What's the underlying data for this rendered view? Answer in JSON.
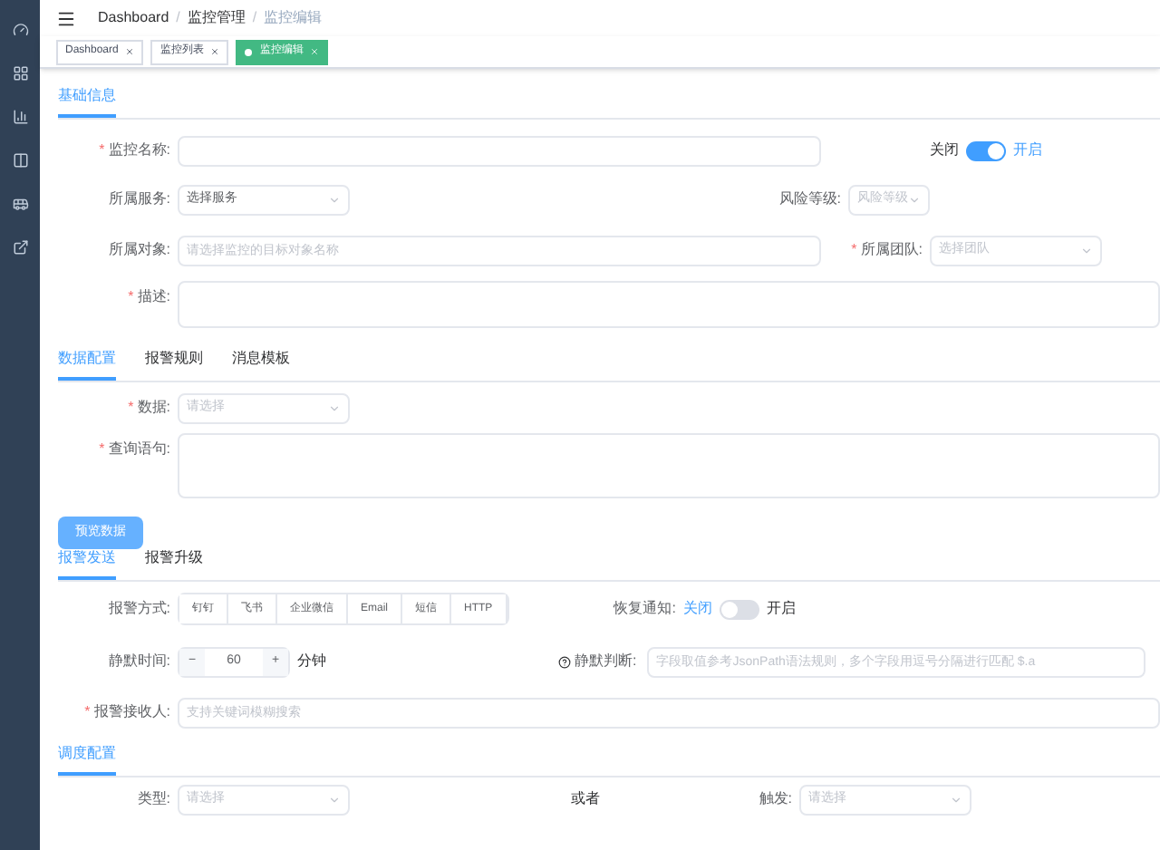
{
  "breadcrumbs": [
    "Dashboard",
    "监控管理",
    "监控编辑"
  ],
  "breadcrumb_separator": "/",
  "required_mark": "*",
  "tags": [
    {
      "label": "Dashboard",
      "selected": false
    },
    {
      "label": "监控列表",
      "selected": false
    },
    {
      "label": "监控编辑",
      "selected": true
    }
  ],
  "basic_section": {
    "tabs": [
      {
        "label": "基础信息",
        "selected": true
      }
    ],
    "name": {
      "label": "监控名称:",
      "required": true
    },
    "enable_switch": {
      "off_label": "关闭",
      "on_label": "开启",
      "on": true
    },
    "service": {
      "label": "所属服务:",
      "value": "选择服务"
    },
    "risk_level": {
      "label": "风险等级:",
      "placeholder": "风险等级"
    },
    "target": {
      "label": "所属对象:",
      "placeholder": "请选择监控的目标对象名称"
    },
    "team": {
      "label": "所属团队:",
      "placeholder": "选择团队",
      "required": true
    },
    "description": {
      "label": "描述:",
      "required": true
    }
  },
  "data_tabs": [
    {
      "label": "数据配置",
      "selected": true
    },
    {
      "label": "报警规则",
      "selected": false
    },
    {
      "label": "消息模板",
      "selected": false
    }
  ],
  "data_source": {
    "label": "数据:",
    "placeholder": "请选择",
    "required": true
  },
  "query": {
    "label": "查询语句:",
    "required": true
  },
  "preview_button": "预览数据",
  "alert_tabs": [
    {
      "label": "报警发送",
      "selected": true
    },
    {
      "label": "报警升级",
      "selected": false
    }
  ],
  "alert_methods": {
    "label": "报警方式:",
    "options": [
      {
        "label": "钉钉",
        "selected": false
      },
      {
        "label": "飞书",
        "selected": false
      },
      {
        "label": "企业微信",
        "selected": false
      },
      {
        "label": "Email",
        "selected": false
      },
      {
        "label": "短信",
        "selected": false
      },
      {
        "label": "HTTP",
        "selected": false
      }
    ]
  },
  "recover_notify": {
    "label": "恢复通知:",
    "off_label": "关闭",
    "on_label": "开启",
    "on": false
  },
  "silence_time": {
    "label": "静默时间:",
    "minus": "−",
    "value": "60",
    "plus": "+",
    "unit": "分钟"
  },
  "silence_judge": {
    "label": "静默判断:",
    "placeholder": "字段取值参考JsonPath语法规则，多个字段用逗号分隔进行匹配 $.a"
  },
  "receivers": {
    "label": "报警接收人:",
    "placeholder": "支持关键词模糊搜索",
    "required": true
  },
  "schedule_tabs": [
    {
      "label": "调度配置",
      "selected": true
    }
  ],
  "schedule": {
    "type": {
      "label": "类型:",
      "placeholder": "请选择"
    },
    "or_text": "或者",
    "trigger": {
      "label": "触发:",
      "placeholder": "请选择"
    }
  }
}
